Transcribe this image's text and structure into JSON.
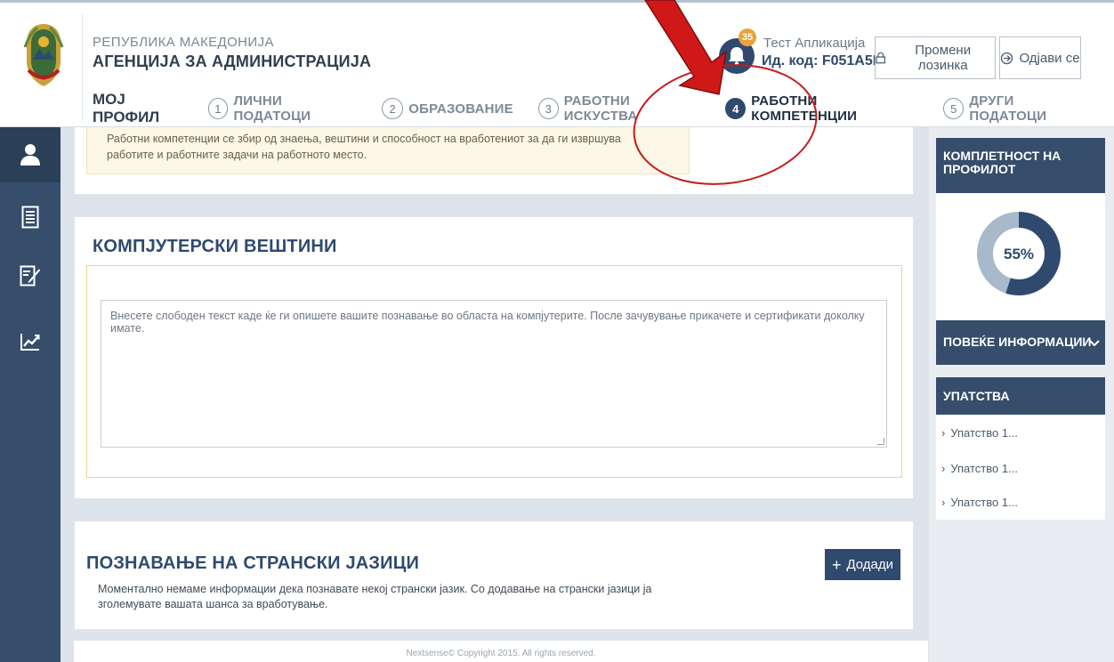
{
  "header": {
    "brand_line1": "РЕПУБЛИКА МАКЕДОНИЈА",
    "brand_line2": "АГЕНЦИЈА ЗА АДМИНИСТРАЦИЈА",
    "notifications_count": "35",
    "user_name": "Тест Апликација",
    "user_code": "Ид. код: F051A5E",
    "change_password": "Промени лозинка",
    "logout": "Одјави се"
  },
  "nav": {
    "profile": "МОЈ ПРОФИЛ",
    "steps": [
      {
        "num": "1",
        "label": "ЛИЧНИ ПОДАТОЦИ"
      },
      {
        "num": "2",
        "label": "ОБРАЗОВАНИЕ"
      },
      {
        "num": "3",
        "label": "РАБОТНИ ИСКУСТВА"
      },
      {
        "num": "4",
        "label": "РАБОТНИ КОМПЕТЕНЦИИ"
      },
      {
        "num": "5",
        "label": "ДРУГИ ПОДАТОЦИ"
      }
    ]
  },
  "sidebar": {
    "icons": [
      "user-icon",
      "document-list-icon",
      "edit-document-icon",
      "chart-trend-icon"
    ]
  },
  "notice": {
    "text": "Работни компетенции се збир од знаења, вештини и способност на вработениот за да ги извршува работите и работните задачи на работното место."
  },
  "computer_skills": {
    "title": "КОМПЈУТЕРСКИ ВЕШТИНИ",
    "placeholder": "Внесете слободен текст каде ќе ги опишете вашите познавање во областа на компјутерите. После зачувување прикачете и сертификати доколку имате."
  },
  "languages": {
    "title": "ПОЗНАВАЊЕ НА СТРАНСКИ ЈАЗИЦИ",
    "add_button": "Додади",
    "text": "Моментално немаме информации дека познавате некој странски јазик. Со додавање на странски јазици ја зголемувате вашата шанса за вработување."
  },
  "footer": {
    "text": "Nextsense© Copyright 2015. All rights reserved."
  },
  "right_panel": {
    "completeness_title": "КОМПЛЕТНОСТ НА ПРОФИЛОТ",
    "completeness_value": "55%",
    "completeness_fraction": 0.55,
    "more_info": "ПОВЕЌЕ ИНФОРМАЦИИ",
    "guides_title": "УПАТСТВА",
    "guides": [
      "Упатство 1...",
      "Упатство 1...",
      "Упатство 1..."
    ]
  },
  "colors": {
    "primary": "#364d6b",
    "accent": "#e8a33a",
    "annotation": "#d01818"
  }
}
